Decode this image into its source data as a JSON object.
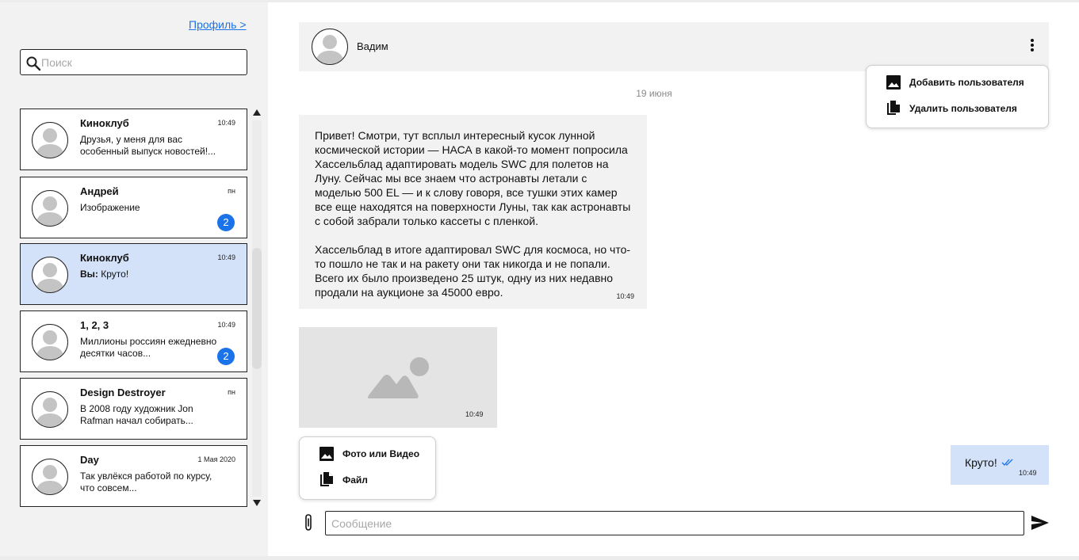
{
  "colors": {
    "sidebar_bg": "#f2f2f2",
    "active_chat_bg": "#d3e2f9",
    "accent": "#1a73e8",
    "placeholder": "#a8a8a8"
  },
  "sidebar": {
    "profile_link": "Профиль >",
    "search": {
      "placeholder": "Поиск",
      "icon": "search-icon"
    },
    "chats": [
      {
        "name": "Киноклуб",
        "time": "10:49",
        "preview": "Друзья, у меня для вас особенный выпуск новостей!...",
        "badge": null,
        "active": false
      },
      {
        "name": "Андрей",
        "time": "пн",
        "preview": "Изображение",
        "badge": "2",
        "active": false
      },
      {
        "name": "Киноклуб",
        "time": "10:49",
        "preview_prefix": "Вы:",
        "preview": "Круто!",
        "badge": null,
        "active": true
      },
      {
        "name": "1, 2, 3",
        "time": "10:49",
        "preview": "Миллионы россиян ежедневно десятки часов...",
        "badge": "2",
        "active": false
      },
      {
        "name": "Design Destroyer",
        "time": "пн",
        "preview": "В 2008 году художник Jon Rafman  начал собирать...",
        "badge": null,
        "active": false
      },
      {
        "name": "Day",
        "time": "1 Мая 2020",
        "preview": "Так увлёкся работой по курсу, что совсем...",
        "badge": null,
        "active": false
      }
    ]
  },
  "chat": {
    "contact_name": "Вадим",
    "menu": {
      "add_user": "Добавить пользователя",
      "remove_user": "Удалить пользователя"
    },
    "date_separator": "19 июня",
    "messages": {
      "incoming_text": "Привет! Смотри, тут всплыл интересный кусок лунной космической истории — НАСА в какой-то момент попросила Хассельблад адаптировать модель SWC для полетов на Луну. Сейчас мы все знаем что астронавты летали с моделью 500 EL — и к слову говоря, все тушки этих камер все еще находятся на поверхности Луны, так как астронавты с собой забрали только кассеты с пленкой.\n\nХассельблад в итоге адаптировал SWC для космоса, но что-то пошло не так и на ракету они так никогда и не попали. Всего их было произведено 25 штук, одну из них недавно продали на аукционе за 45000 евро.",
      "incoming_time": "10:49",
      "image_time": "10:49",
      "outgoing_text": "Круто!",
      "outgoing_time": "10:49"
    },
    "attach_menu": {
      "photo_video": "Фото или Видео",
      "file": "Файл"
    },
    "input": {
      "placeholder": "Сообщение"
    }
  }
}
